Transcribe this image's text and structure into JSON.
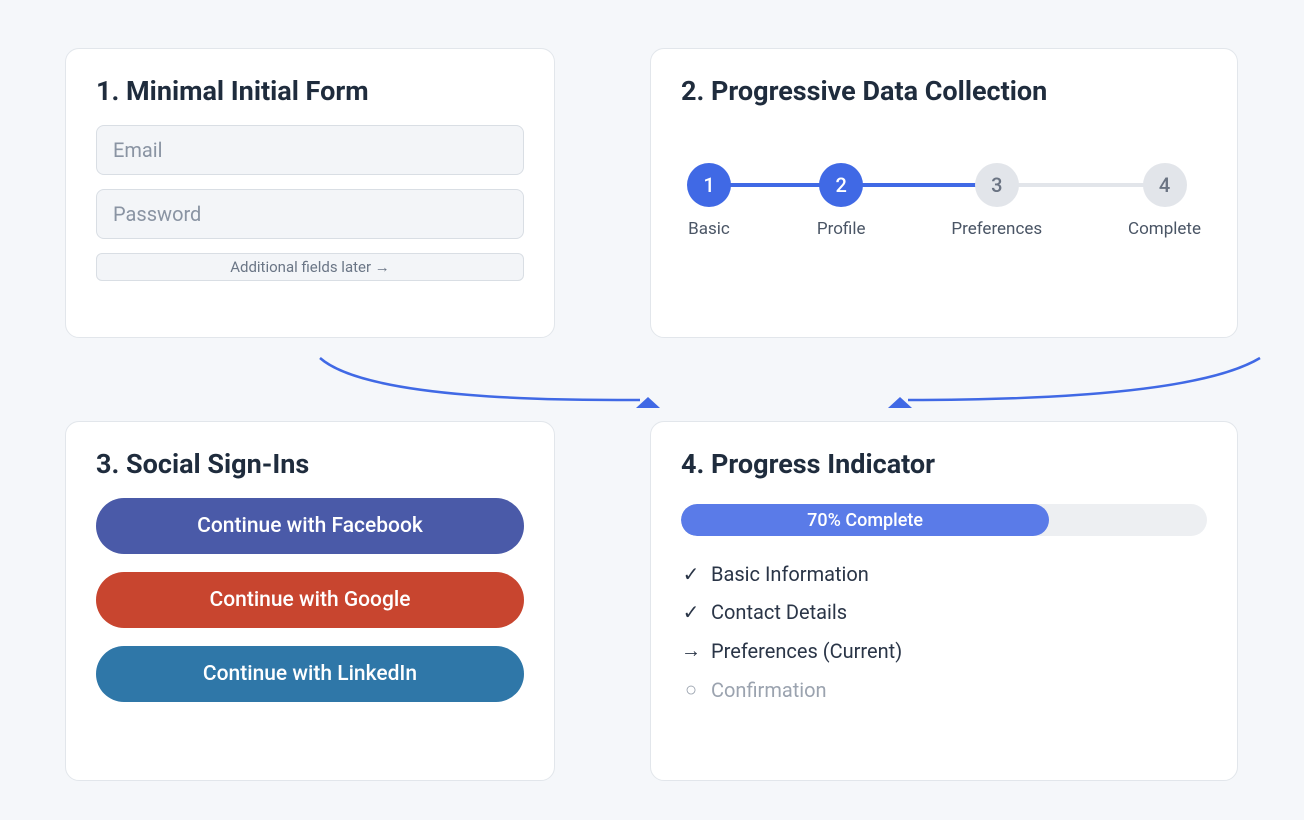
{
  "card1": {
    "title": "1. Minimal Initial Form",
    "email_placeholder": "Email",
    "password_placeholder": "Password",
    "additional_later": "Additional fields later →"
  },
  "card2": {
    "title": "2. Progressive Data Collection",
    "steps": [
      {
        "num": "1",
        "label": "Basic",
        "active": true
      },
      {
        "num": "2",
        "label": "Profile",
        "active": true
      },
      {
        "num": "3",
        "label": "Preferences",
        "active": false
      },
      {
        "num": "4",
        "label": "Complete",
        "active": false
      }
    ]
  },
  "card3": {
    "title": "3. Social Sign-Ins",
    "facebook_label": "Continue with Facebook",
    "google_label": "Continue with Google",
    "linkedin_label": "Continue with LinkedIn"
  },
  "card4": {
    "title": "4. Progress Indicator",
    "progress_percent": 70,
    "progress_label": "70% Complete",
    "items": [
      {
        "icon": "✓",
        "label": "Basic Information",
        "state": "done"
      },
      {
        "icon": "✓",
        "label": "Contact Details",
        "state": "done"
      },
      {
        "icon": "→",
        "label": "Preferences (Current)",
        "state": "current"
      },
      {
        "icon": "○",
        "label": "Confirmation",
        "state": "pending"
      }
    ]
  },
  "colors": {
    "accent": "#4069e5",
    "facebook": "#4a5aa8",
    "google": "#c8452f",
    "linkedin": "#2f77a8"
  }
}
